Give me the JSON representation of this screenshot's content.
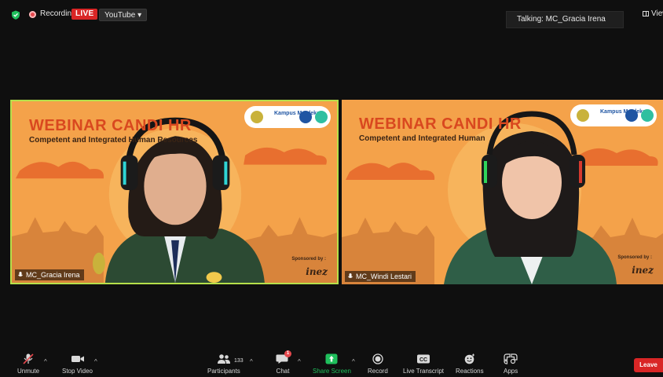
{
  "topbar": {
    "recording_label": "Recording",
    "live_label": "LIVE",
    "stream_target": "YouTube",
    "talking_label": "Talking: MC_Gracia Irena",
    "view_label": "View"
  },
  "tiles": [
    {
      "title": "WEBINAR CANDI HR",
      "subtitle": "Competent and Integrated Human Resources",
      "logo_text": "Kampus Merdeka",
      "sponsor_label": "Sponsored by :",
      "sponsor_name": "inez",
      "participant_name": "MC_Gracia Irena",
      "active_speaker": true
    },
    {
      "title": "WEBINAR CANDI HR",
      "subtitle": "Competent and Integrated Human",
      "logo_text": "Kampus Merdeka",
      "sponsor_label": "Sponsored by :",
      "sponsor_name": "inez",
      "participant_name": "MC_Windi Lestari",
      "active_speaker": false
    }
  ],
  "toolbar": {
    "unmute": "Unmute",
    "stop_video": "Stop Video",
    "participants": "Participants",
    "participants_count": "133",
    "chat": "Chat",
    "chat_badge": "1",
    "share_screen": "Share Screen",
    "record": "Record",
    "live_transcript": "Live Transcript",
    "reactions": "Reactions",
    "apps": "Apps",
    "leave": "Leave"
  },
  "colors": {
    "accent_green": "#1fbf5c",
    "live_red": "#d92626",
    "active_border": "#b6e04a",
    "slide_orange": "#f4a24a",
    "title_red": "#d9481f"
  },
  "icons": {
    "security": "shield-icon",
    "recording": "record-dot-icon",
    "mic_muted": "mic-muted-icon",
    "video": "video-camera-icon",
    "participants": "people-icon",
    "chat": "chat-bubble-icon",
    "share": "share-screen-icon",
    "record": "record-icon",
    "transcript": "cc-icon",
    "reactions": "emoji-icon",
    "apps": "apps-icon"
  }
}
